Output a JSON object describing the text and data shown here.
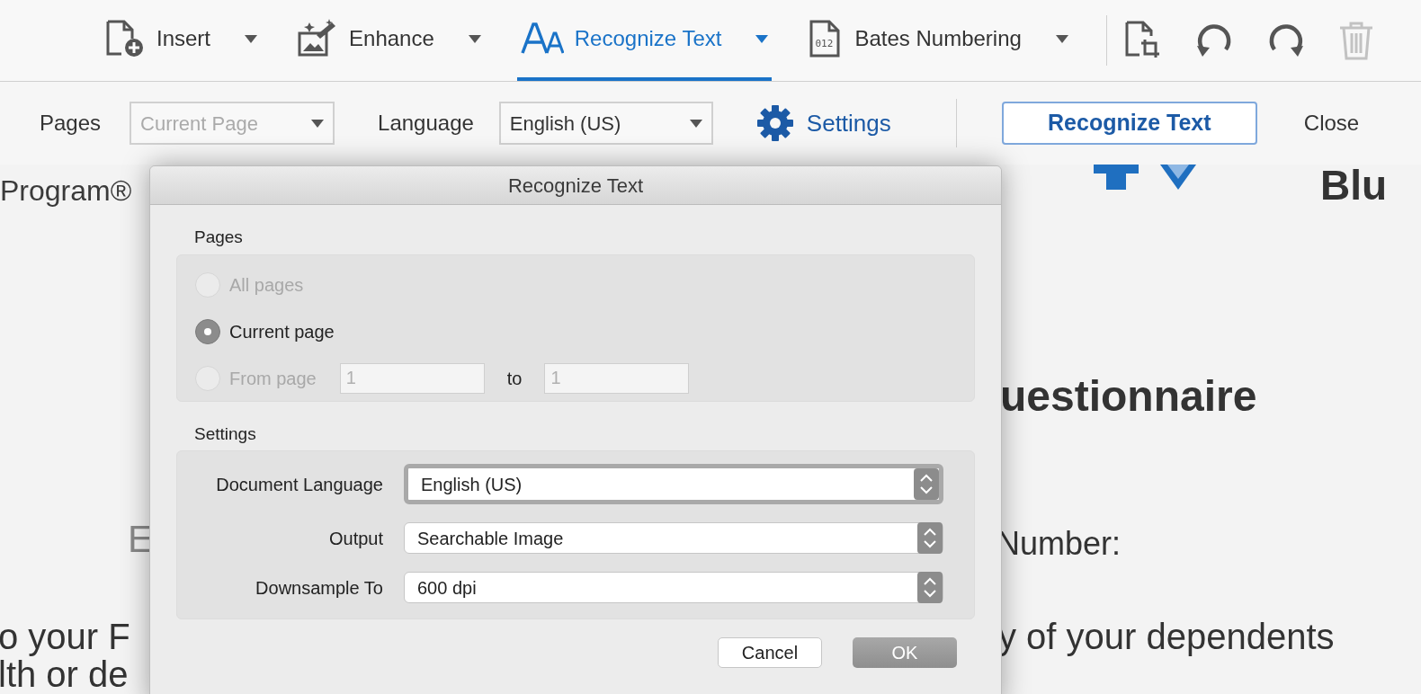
{
  "toolbar": {
    "tools": [
      {
        "kind": "insert",
        "label": "Insert",
        "selected": false
      },
      {
        "kind": "enhance",
        "label": "Enhance",
        "selected": false
      },
      {
        "kind": "recognize",
        "label": "Recognize Text",
        "selected": true
      },
      {
        "kind": "bates",
        "label": "Bates Numbering",
        "icon_text": "012",
        "selected": false
      }
    ],
    "actions": [
      {
        "kind": "crop",
        "disabled": false
      },
      {
        "kind": "undo",
        "disabled": false
      },
      {
        "kind": "redo",
        "disabled": false
      },
      {
        "kind": "delete",
        "disabled": true
      }
    ]
  },
  "options_bar": {
    "pages_label": "Pages",
    "pages_value": "Current Page",
    "pages_disabled": true,
    "language_label": "Language",
    "language_value": "English (US)",
    "settings": "Settings",
    "recognize_button": "Recognize Text",
    "close": "Close"
  },
  "document": {
    "fragments": [
      "Program®",
      "Blu",
      "uestionnaire",
      "E",
      "Number:",
      "o your F",
      "y of your dependents",
      "lth or de"
    ]
  },
  "dialog": {
    "title": "Recognize Text",
    "pages_section": {
      "label": "Pages",
      "options": [
        {
          "label": "All pages",
          "selected": false,
          "disabled": true
        },
        {
          "label": "Current page",
          "selected": true,
          "disabled": false
        },
        {
          "label": "From page",
          "selected": false,
          "disabled": true
        }
      ],
      "from_value": "1",
      "to_label": "to",
      "to_value": "1"
    },
    "settings_section": {
      "label": "Settings",
      "rows": [
        {
          "label": "Document Language",
          "value": "English (US)",
          "focused": true
        },
        {
          "label": "Output",
          "value": "Searchable Image",
          "focused": false
        },
        {
          "label": "Downsample To",
          "value": "600 dpi",
          "focused": false
        }
      ]
    },
    "buttons": [
      {
        "label": "Cancel",
        "default": false
      },
      {
        "label": "OK",
        "default": true
      }
    ]
  }
}
